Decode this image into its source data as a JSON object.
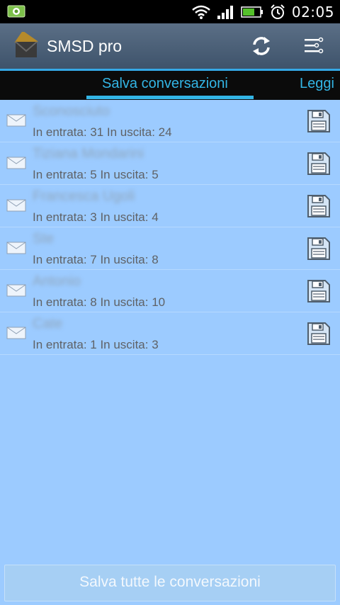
{
  "status_bar": {
    "time": "02:05"
  },
  "app": {
    "title": "SMSD pro"
  },
  "tabs": [
    {
      "label": "Salva conversazioni",
      "selected": true
    },
    {
      "label": "Leggi",
      "selected": false
    }
  ],
  "conversations": [
    {
      "name": "Sconosciuto",
      "counts": "In entrata: 31 In uscita: 24"
    },
    {
      "name": "Tiziana Mondarini",
      "counts": "In entrata: 5 In uscita: 5"
    },
    {
      "name": "Francesca Ugoli",
      "counts": "In entrata: 3 In uscita: 4"
    },
    {
      "name": "Ste",
      "counts": "In entrata: 7 In uscita: 8"
    },
    {
      "name": "Antonio",
      "counts": "In entrata: 8 In uscita: 10"
    },
    {
      "name": "Cate",
      "counts": "In entrata: 1 In uscita: 3"
    }
  ],
  "bottom_button": {
    "label": "Salva tutte le conversazioni"
  },
  "colors": {
    "accent": "#33b5e5",
    "background": "#9ccbff",
    "action_bar": "#4a5e76"
  }
}
